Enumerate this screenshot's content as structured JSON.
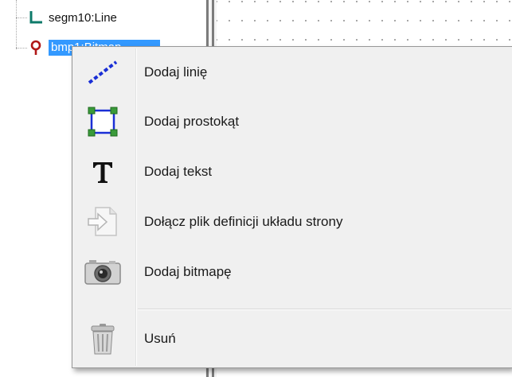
{
  "tree": {
    "nodes": [
      {
        "label": "segm10:Line",
        "icon": "line-segment-icon",
        "selected": false
      },
      {
        "label": "bmp1:Bitmap",
        "icon": "pin-icon",
        "selected": true
      }
    ]
  },
  "context_menu": {
    "items": [
      {
        "label": "Dodaj linię",
        "icon": "line-icon"
      },
      {
        "label": "Dodaj prostokąt",
        "icon": "rectangle-icon"
      },
      {
        "label": "Dodaj tekst",
        "icon": "text-icon"
      },
      {
        "label": "Dołącz plik definicji układu strony",
        "icon": "attach-file-icon"
      },
      {
        "label": "Dodaj bitmapę",
        "icon": "camera-icon"
      },
      {
        "label": "Usuń",
        "icon": "trash-icon"
      }
    ]
  },
  "colors": {
    "selection": "#3399ff",
    "tree_line_icon": "#0e7a6a",
    "pin_icon": "#b01818",
    "menu_background": "#f0f0f0",
    "line_icon": "#1a2fd6",
    "rectangle_fill": "#3a9a3a"
  }
}
